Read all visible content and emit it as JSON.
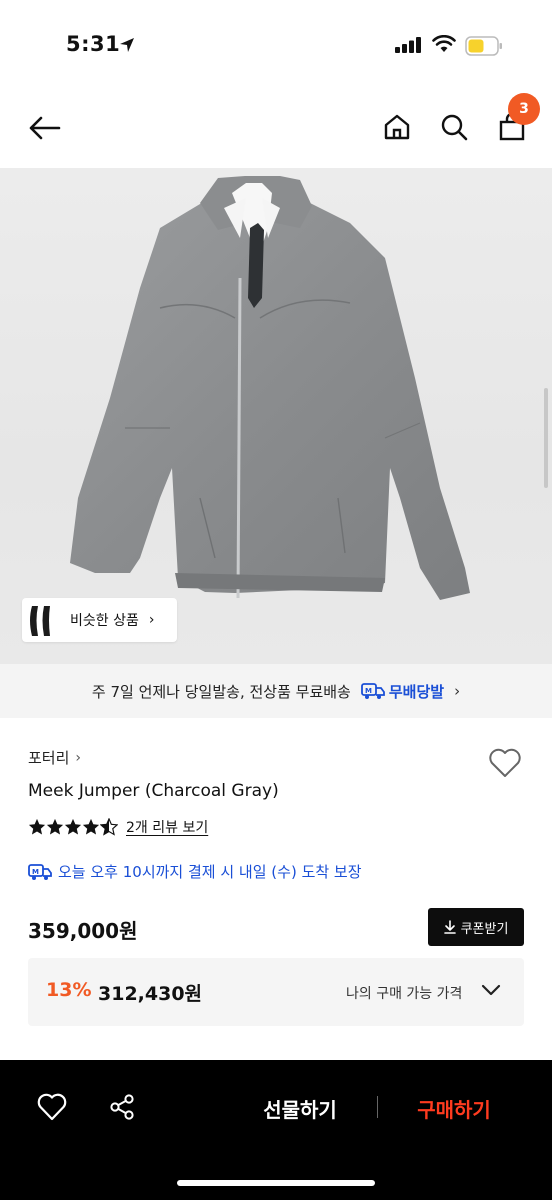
{
  "status_bar": {
    "time": "5:31"
  },
  "nav": {
    "cart_count": "3"
  },
  "image": {
    "similar_products_label": "비슷한 상품",
    "similar_chevron": "›"
  },
  "delivery": {
    "text": "주 7일 언제나 당일발송, 전상품 무료배송",
    "free_shipping_label": "무배당발",
    "chevron": "›"
  },
  "product": {
    "brand": "포터리",
    "brand_chevron": "›",
    "name": "Meek Jumper (Charcoal Gray)",
    "rating": 4.5,
    "review_link": "2개 리뷰 보기",
    "arrival_guarantee": "오늘 오후 10시까지 결제 시 내일 (수) 도착 보장",
    "price": "359,000원",
    "coupon_label": "쿠폰받기",
    "discount_rate": "13%",
    "discount_price": "312,430원",
    "my_price_label": "나의 구매 가능 가격"
  },
  "bottom_bar": {
    "gift_label": "선물하기",
    "buy_label": "구매하기"
  },
  "colors": {
    "accent_orange": "#f15a24",
    "buy_red": "#ff3b1f",
    "link_blue": "#1a4fd6",
    "bottom_bar": "#000000"
  },
  "icons": [
    "location-arrow-icon",
    "signal-icon",
    "wifi-icon",
    "battery-icon",
    "back-arrow-icon",
    "home-icon",
    "search-icon",
    "cart-icon",
    "heart-icon",
    "share-icon",
    "download-icon",
    "chevron-down-icon",
    "star-icon",
    "truck-icon"
  ]
}
